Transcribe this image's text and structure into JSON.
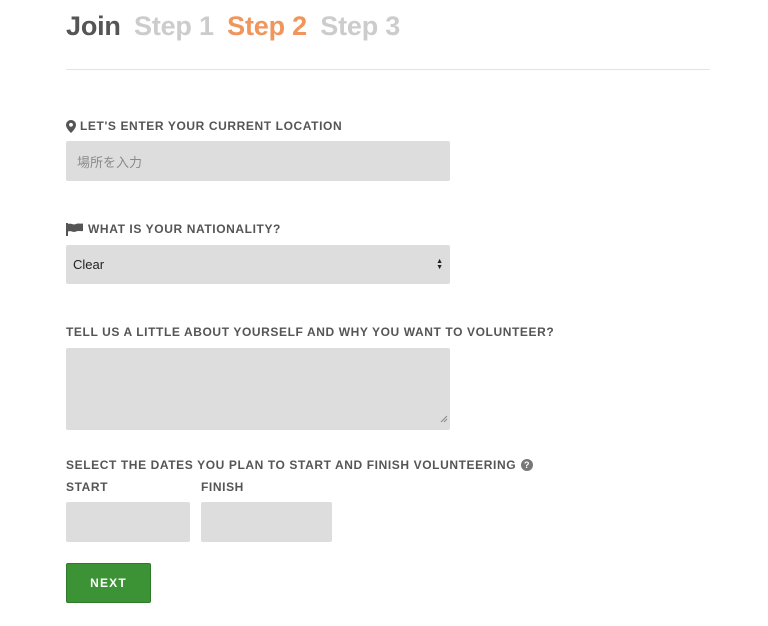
{
  "header": {
    "join": "Join",
    "steps": [
      "Step 1",
      "Step 2",
      "Step 3"
    ],
    "active_step": "Step 2",
    "active_color": "#f0955b"
  },
  "location": {
    "label": "LET'S ENTER YOUR CURRENT LOCATION",
    "icon": "map-pin-icon",
    "placeholder": "場所を入力"
  },
  "nationality": {
    "label": "WHAT IS YOUR NATIONALITY?",
    "icon": "flag-icon",
    "selected": "Clear"
  },
  "about": {
    "label": "TELL US A LITTLE ABOUT YOURSELF AND WHY YOU WANT TO VOLUNTEER?",
    "value": ""
  },
  "dates": {
    "label": "SELECT THE DATES YOU PLAN TO START AND FINISH VOLUNTEERING",
    "help_icon": "question-circle-icon",
    "start_label": "START",
    "finish_label": "FINISH"
  },
  "next_button": {
    "label": "NEXT",
    "color": "#3c9336"
  }
}
